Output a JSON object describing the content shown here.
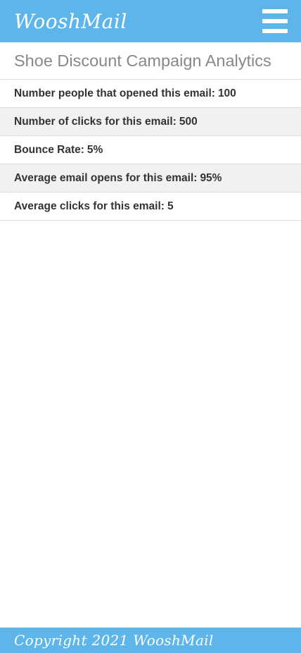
{
  "header": {
    "app_title": "WooshMail",
    "menu_icon": "hamburger-menu-icon"
  },
  "page": {
    "title": "Shoe Discount Campaign Analytics"
  },
  "stats": [
    {
      "label": "Number people that opened this email:",
      "value": "100"
    },
    {
      "label": "Number of clicks for this email:",
      "value": "500"
    },
    {
      "label": "Bounce Rate:",
      "value": "5%"
    },
    {
      "label": "Average email opens for this email:",
      "value": "95%"
    },
    {
      "label": "Average clicks for this email:",
      "value": "5"
    }
  ],
  "footer": {
    "text": "Copyright 2021 WooshMail"
  },
  "colors": {
    "accent": "#5db5ea",
    "row_alt": "#f1f1f1",
    "text": "#333333",
    "title_text": "#888888"
  }
}
